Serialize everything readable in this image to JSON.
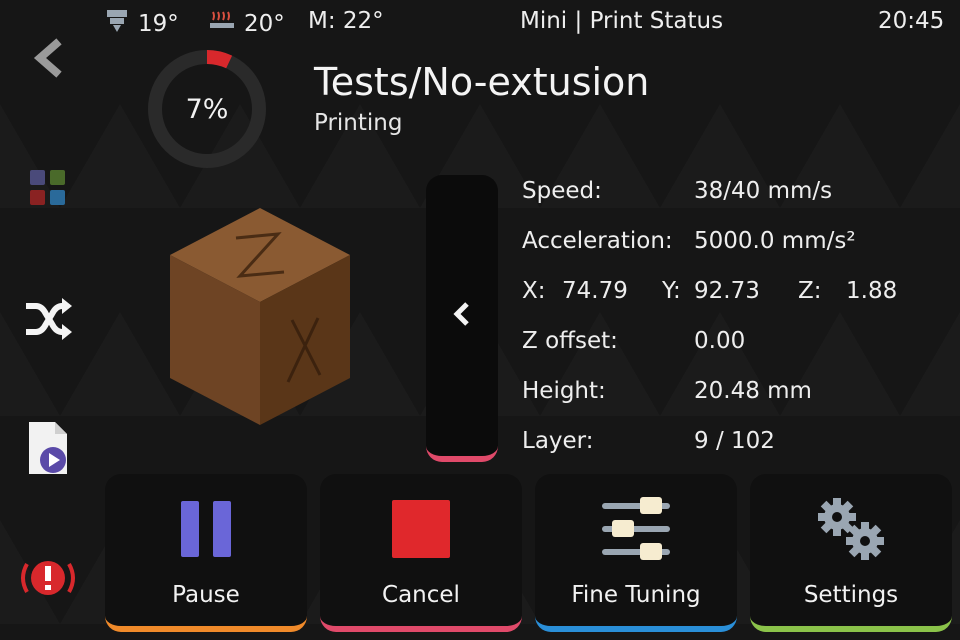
{
  "topbar": {
    "extruder_temp": "19°",
    "bed_temp": "20°",
    "mcu_temp": "M: 22°",
    "title": "Mini | Print Status",
    "time": "20:45"
  },
  "sidenav": {
    "items": [
      {
        "icon": "back-arrow-icon"
      },
      {
        "icon": "grid-menu-icon"
      },
      {
        "icon": "shuffle-icon"
      },
      {
        "icon": "file-play-icon"
      },
      {
        "icon": "emergency-stop-icon"
      }
    ]
  },
  "job": {
    "progress_label": "7%",
    "progress": 0.07,
    "title": "Tests/No-extusion",
    "state": "Printing"
  },
  "info": {
    "speed_label": "Speed:",
    "speed_value": "38/40 mm/s",
    "accel_label": "Acceleration:",
    "accel_value": "5000.0 mm/s²",
    "x_label": "X:",
    "x_value": "74.79",
    "y_label": "Y:",
    "y_value": "92.73",
    "z_label": "Z:",
    "z_value": "1.88",
    "zoffset_label": "Z offset:",
    "zoffset_value": "0.00",
    "height_label": "Height:",
    "height_value": "20.48 mm",
    "layer_label": "Layer:",
    "layer_value": "9 / 102"
  },
  "actions": {
    "pause": "Pause",
    "cancel": "Cancel",
    "fine_tuning": "Fine Tuning",
    "settings": "Settings"
  },
  "colors": {
    "progress_accent": "#d8282c",
    "pause_accent": "#f08a2a",
    "cancel_accent": "#e04a6a",
    "tune_accent": "#2a8fd8",
    "settings_accent": "#8bc34a"
  }
}
